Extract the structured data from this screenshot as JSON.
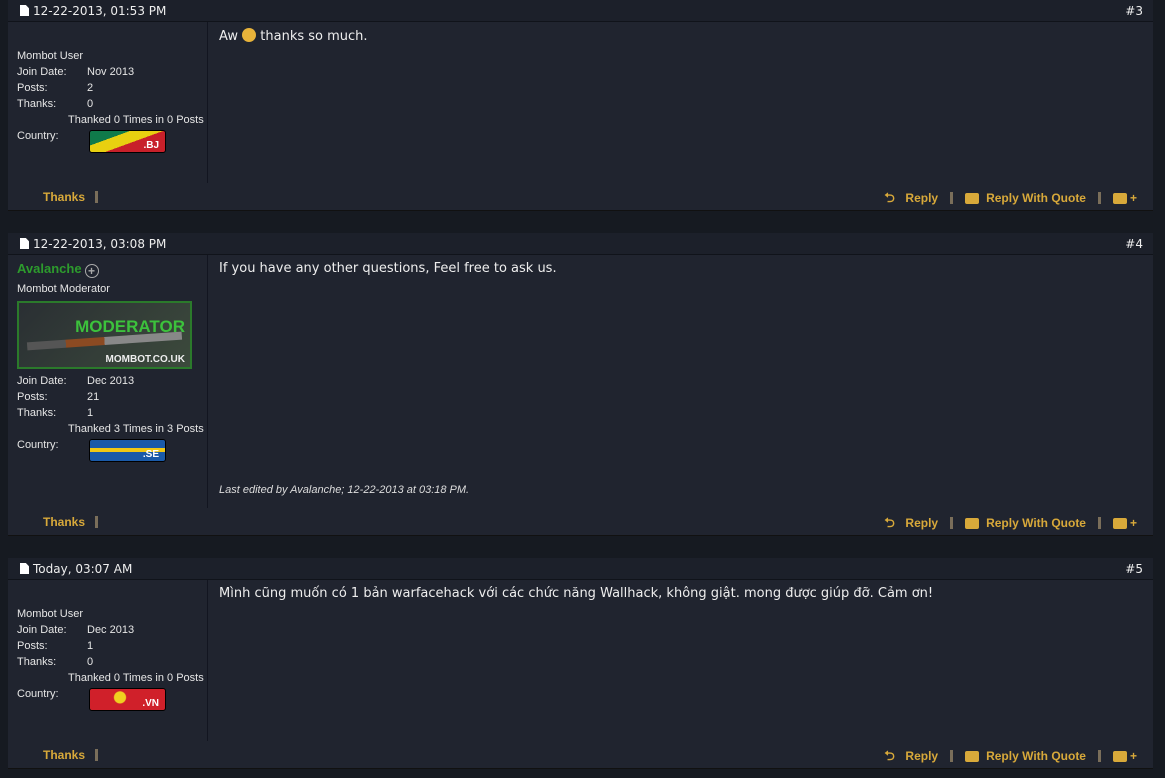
{
  "posts": [
    {
      "date": "12-22-2013, 01:53 PM",
      "number": "#3",
      "username": "",
      "user_title": "Mombot User",
      "join_label": "Join Date:",
      "join_date": "Nov 2013",
      "posts_label": "Posts:",
      "posts": "2",
      "thanks_label": "Thanks:",
      "thanks": "0",
      "thanked": "Thanked 0 Times in 0 Posts",
      "country_label": "Country:",
      "country_code": ".BJ",
      "message_before": "Aw",
      "message_after": "thanks so much.",
      "edited": "",
      "flag_colors": [
        "#0f7a4a",
        "#e8d010",
        "#c8202a"
      ]
    },
    {
      "date": "12-22-2013, 03:08 PM",
      "number": "#4",
      "username": "Avalanche",
      "user_title": "Mombot Moderator",
      "badge_title": "MODERATOR",
      "badge_site": "MOMBOT.CO.UK",
      "join_label": "Join Date:",
      "join_date": "Dec 2013",
      "posts_label": "Posts:",
      "posts": "21",
      "thanks_label": "Thanks:",
      "thanks": "1",
      "thanked": "Thanked 3 Times in 3 Posts",
      "country_label": "Country:",
      "country_code": ".SE",
      "message": "If you have any other questions, Feel free to ask us.",
      "edited": "Last edited by Avalanche; 12-22-2013 at 03:18 PM.",
      "flag_colors": [
        "#1a5aa8",
        "#f0c814"
      ]
    },
    {
      "date": "Today, 03:07 AM",
      "number": "#5",
      "username": "",
      "user_title": "Mombot User",
      "join_label": "Join Date:",
      "join_date": "Dec 2013",
      "posts_label": "Posts:",
      "posts": "1",
      "thanks_label": "Thanks:",
      "thanks": "0",
      "thanked": "Thanked 0 Times in 0 Posts",
      "country_label": "Country:",
      "country_code": ".VN",
      "message": "Mình cũng muốn có 1 bản warfacehack với các chức năng Wallhack, không giật. mong được giúp đỡ. Cảm ơn!",
      "edited": "",
      "flag_colors": [
        "#d0202a",
        "#f0d020"
      ]
    }
  ],
  "actions": {
    "thanks": "Thanks",
    "reply": "Reply",
    "reply_quote": "Reply With Quote"
  },
  "colors": {
    "accent": "#d8a93a",
    "username": "#2d9b2d",
    "background": "#161a21",
    "post": "#20242f"
  }
}
